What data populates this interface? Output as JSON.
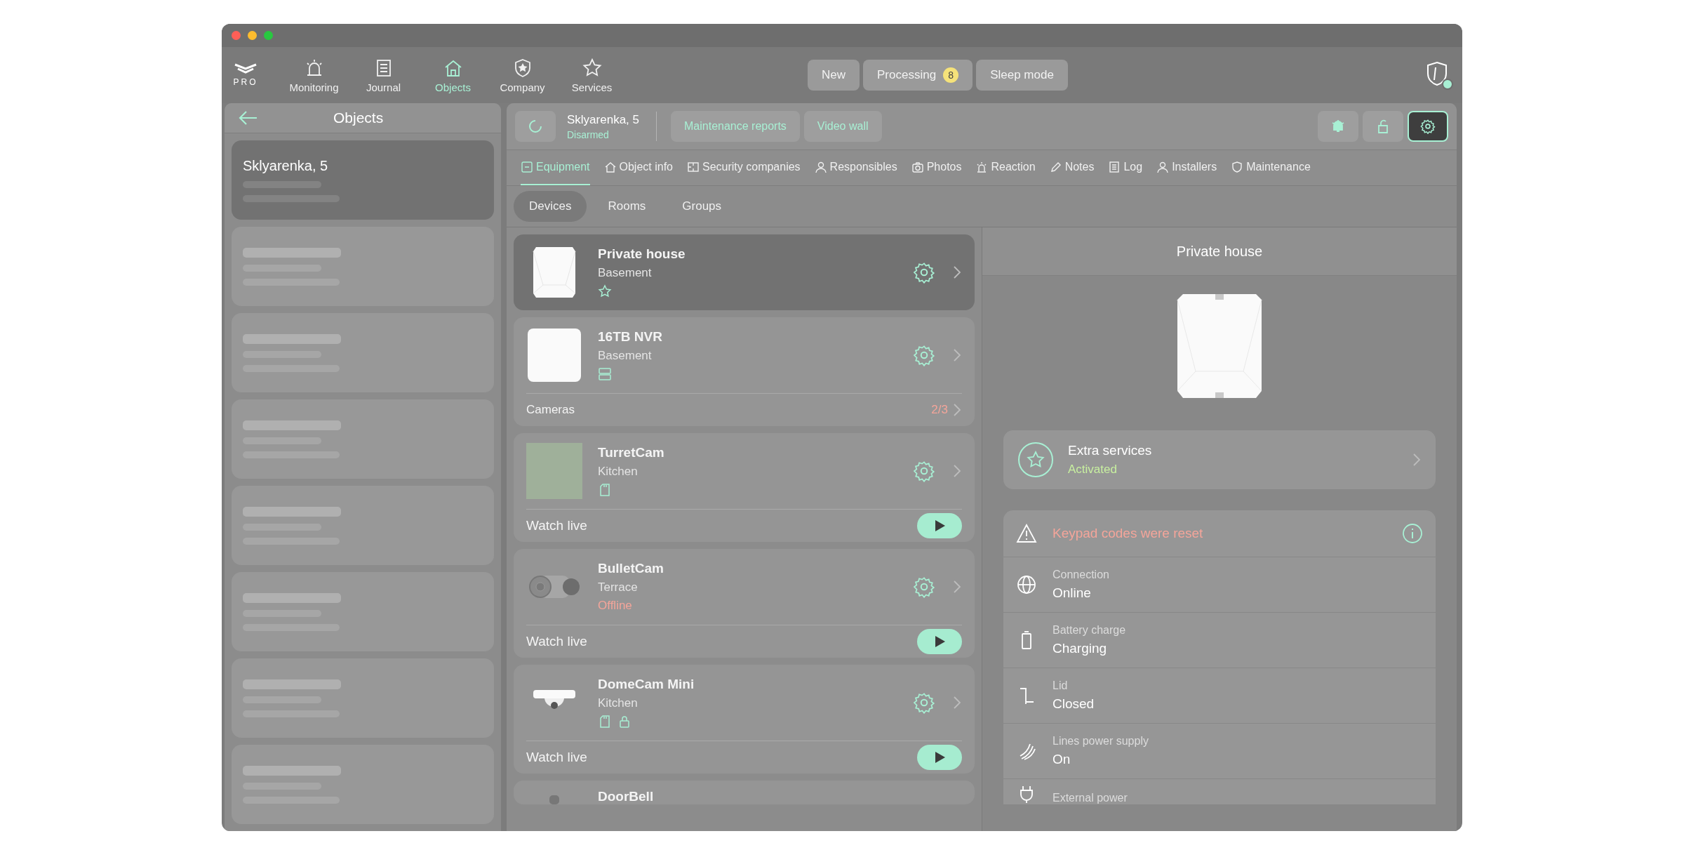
{
  "window": {
    "controls": [
      {
        "color": "#ff5f57"
      },
      {
        "color": "#febc2e"
      },
      {
        "color": "#28c840"
      }
    ]
  },
  "logo": {
    "text": "PRO"
  },
  "nav": [
    {
      "label": "Monitoring",
      "selected": false
    },
    {
      "label": "Journal",
      "selected": false
    },
    {
      "label": "Objects",
      "selected": true
    },
    {
      "label": "Company",
      "selected": false
    },
    {
      "label": "Services",
      "selected": false
    }
  ],
  "status_buttons": [
    {
      "label": "New"
    },
    {
      "label": "Processing",
      "badge": "8"
    },
    {
      "label": "Sleep mode"
    }
  ],
  "sidebar": {
    "title": "Objects",
    "items": [
      {
        "name": "Sklyarenka, 5",
        "selected": true
      },
      {
        "selected": false
      },
      {
        "selected": false
      },
      {
        "selected": false
      },
      {
        "selected": false
      },
      {
        "selected": false
      },
      {
        "selected": false
      },
      {
        "selected": false
      }
    ]
  },
  "object_header": {
    "name": "Sklyarenka, 5",
    "status": "Disarmed",
    "buttons": [
      "Maintenance reports",
      "Video wall"
    ]
  },
  "tabs": [
    {
      "label": "Equipment",
      "selected": true
    },
    {
      "label": "Object info",
      "selected": false
    },
    {
      "label": "Security companies",
      "selected": false
    },
    {
      "label": "Responsibles",
      "selected": false
    },
    {
      "label": "Photos",
      "selected": false
    },
    {
      "label": "Reaction",
      "selected": false
    },
    {
      "label": "Notes",
      "selected": false
    },
    {
      "label": "Log",
      "selected": false
    },
    {
      "label": "Installers",
      "selected": false
    },
    {
      "label": "Maintenance",
      "selected": false
    }
  ],
  "sub_tabs": [
    {
      "label": "Devices",
      "selected": true
    },
    {
      "label": "Rooms",
      "selected": false
    },
    {
      "label": "Groups",
      "selected": false
    }
  ],
  "devices": [
    {
      "kind": "hub",
      "name": "Private house",
      "room": "Basement",
      "selected": true
    },
    {
      "kind": "nvr",
      "name": "16TB NVR",
      "room": "Basement",
      "selected": false,
      "footer": {
        "label": "Cameras",
        "count": "2/3"
      }
    },
    {
      "kind": "turret",
      "name": "TurretCam",
      "room": "Kitchen",
      "selected": false,
      "footer": {
        "label": "Watch live"
      }
    },
    {
      "kind": "bullet",
      "name": "BulletCam",
      "room": "Terrace",
      "status": "Offline",
      "selected": false,
      "footer": {
        "label": "Watch live"
      }
    },
    {
      "kind": "dome",
      "name": "DomeCam Mini",
      "room": "Kitchen",
      "selected": false,
      "footer": {
        "label": "Watch live"
      }
    },
    {
      "kind": "doorbell",
      "name": "DoorBell",
      "selected": false
    }
  ],
  "detail": {
    "title": "Private house",
    "extra_services": {
      "label": "Extra services",
      "status": "Activated"
    },
    "alert": "Keypad codes were reset",
    "rows": [
      {
        "label": "Connection",
        "value": "Online"
      },
      {
        "label": "Battery charge",
        "value": "Charging"
      },
      {
        "label": "Lid",
        "value": "Closed"
      },
      {
        "label": "Lines power supply",
        "value": "On"
      },
      {
        "label": "External power"
      }
    ]
  }
}
